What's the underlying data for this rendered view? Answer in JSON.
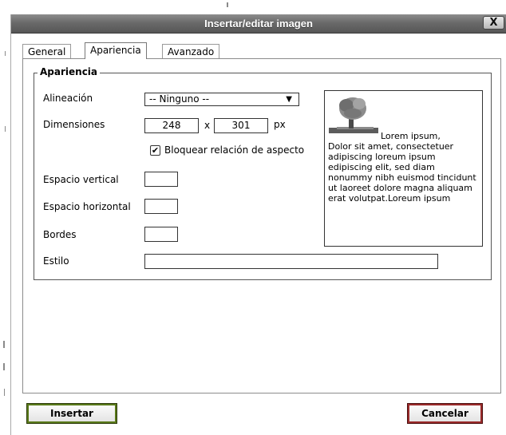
{
  "dialog": {
    "title": "Insertar/editar imagen",
    "close_label": "X"
  },
  "tabs": [
    {
      "label": "General",
      "active": false
    },
    {
      "label": "Apariencia",
      "active": true
    },
    {
      "label": "Avanzado",
      "active": false
    }
  ],
  "appearance": {
    "legend": "Apariencia",
    "alignment": {
      "label": "Alineación",
      "value": "-- Ninguno --"
    },
    "dimensions": {
      "label": "Dimensiones",
      "width": "248",
      "separator": "x",
      "height": "301",
      "unit": "px"
    },
    "constrain": {
      "label": "Bloquear relación de aspecto",
      "checked": true
    },
    "vspace": {
      "label": "Espacio vertical",
      "value": ""
    },
    "hspace": {
      "label": "Espacio horizontal",
      "value": ""
    },
    "border": {
      "label": "Bordes",
      "value": ""
    },
    "style": {
      "label": "Estilo",
      "value": ""
    },
    "preview_text_lead": "Lorem ipsum,",
    "preview_text": "Dolor sit amet, consectetuer adipiscing loreum ipsum edipiscing elit, sed diam nonummy nibh euismod tincidunt ut laoreet dolore magna aliquam erat volutpat.Loreum ipsum"
  },
  "buttons": {
    "insert": "Insertar",
    "cancel": "Cancelar"
  },
  "icons": {
    "close": "close-icon",
    "dropdown": "chevron-down-icon",
    "checkbox": "check-icon",
    "preview_image": "tree-image"
  }
}
